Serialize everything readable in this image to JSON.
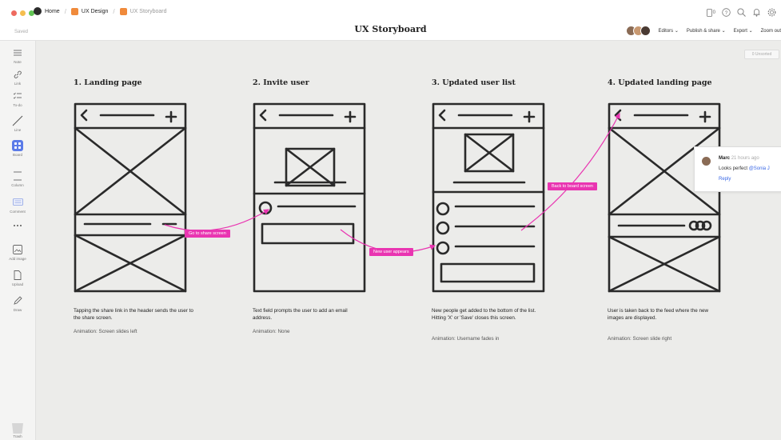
{
  "breadcrumb": {
    "home": "Home",
    "folder": "UX Design",
    "current": "UX Storyboard"
  },
  "status": {
    "saved": "Saved"
  },
  "board_title": "UX Storyboard",
  "topbar": {
    "notifications_count": "0",
    "editors": "Editors ⌄",
    "publish": "Publish & share ⌄",
    "export": "Export ⌄",
    "zoom": "Zoom out"
  },
  "sidebar": {
    "items": [
      {
        "label": "Note",
        "icon": "note-icon"
      },
      {
        "label": "Link",
        "icon": "link-icon"
      },
      {
        "label": "To-do",
        "icon": "todo-icon"
      },
      {
        "label": "Line",
        "icon": "line-icon"
      },
      {
        "label": "Board",
        "icon": "board-icon"
      },
      {
        "label": "Column",
        "icon": "column-icon"
      },
      {
        "label": "Comment",
        "icon": "comment-icon"
      },
      {
        "label": "",
        "icon": "more-icon"
      },
      {
        "label": "Add image",
        "icon": "image-icon"
      },
      {
        "label": "Upload",
        "icon": "upload-icon"
      },
      {
        "label": "Draw",
        "icon": "pen-icon"
      }
    ],
    "trash": "Trash"
  },
  "unsorted": "0 Unsorted",
  "frames": [
    {
      "title": "1. Landing page",
      "desc": "Tapping the share link in the header sends the user to the share screen.",
      "anim": "Animation: Screen slides left"
    },
    {
      "title": "2. Invite user",
      "desc": "Text field prompts the user to add an email address.",
      "anim": "Animation: None"
    },
    {
      "title": "3. Updated user list",
      "desc": "New people get added to the bottom of the list. Hitting 'X' or 'Save' closes this screen.",
      "anim": "Animation: Username fades in"
    },
    {
      "title": "4. Updated landing page",
      "desc": "User is taken back to the feed where the new images are displayed.",
      "anim": "Animation: Screen slide right"
    }
  ],
  "arrows": {
    "a1": "Go to share screen",
    "a2": "New user appears",
    "a3": "Back to board screen"
  },
  "comment": {
    "name": "Marc",
    "time": "21 hours ago",
    "text": "Looks perfect ",
    "mention": "@Sonia J",
    "reply": "Reply"
  },
  "colors": {
    "accent": "#e935b1",
    "link": "#3a68e6",
    "board_active": "#5b7be8"
  }
}
